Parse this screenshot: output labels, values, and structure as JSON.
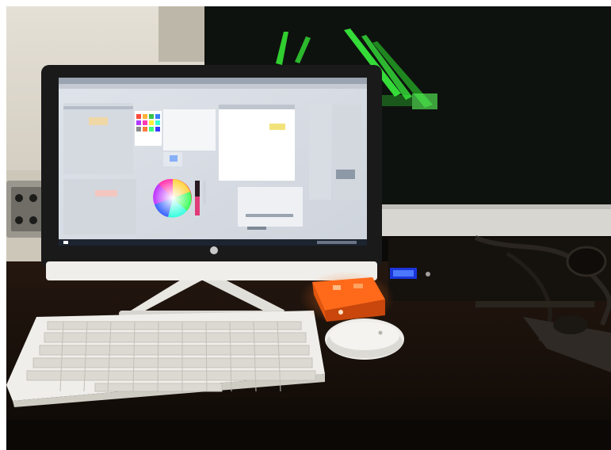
{
  "scene": {
    "colors": {
      "wall": "#d9d4c7",
      "dark_room": "#0a0c0a",
      "stage_laser": "#39ff3a",
      "monitor_bezel": "#1a1a1b",
      "monitor_stand": "#e9e7e2",
      "keyboard": "#efeeea",
      "interface_box": "#ff6a1a",
      "desk": "#1a120d"
    },
    "objects": [
      "monitor-icon",
      "keyboard-icon",
      "mouse-icon",
      "dmx-interface-box-icon",
      "color-wheel-icon",
      "second-display-icon",
      "laser-beams-icon",
      "wall-outlet-icon"
    ]
  }
}
